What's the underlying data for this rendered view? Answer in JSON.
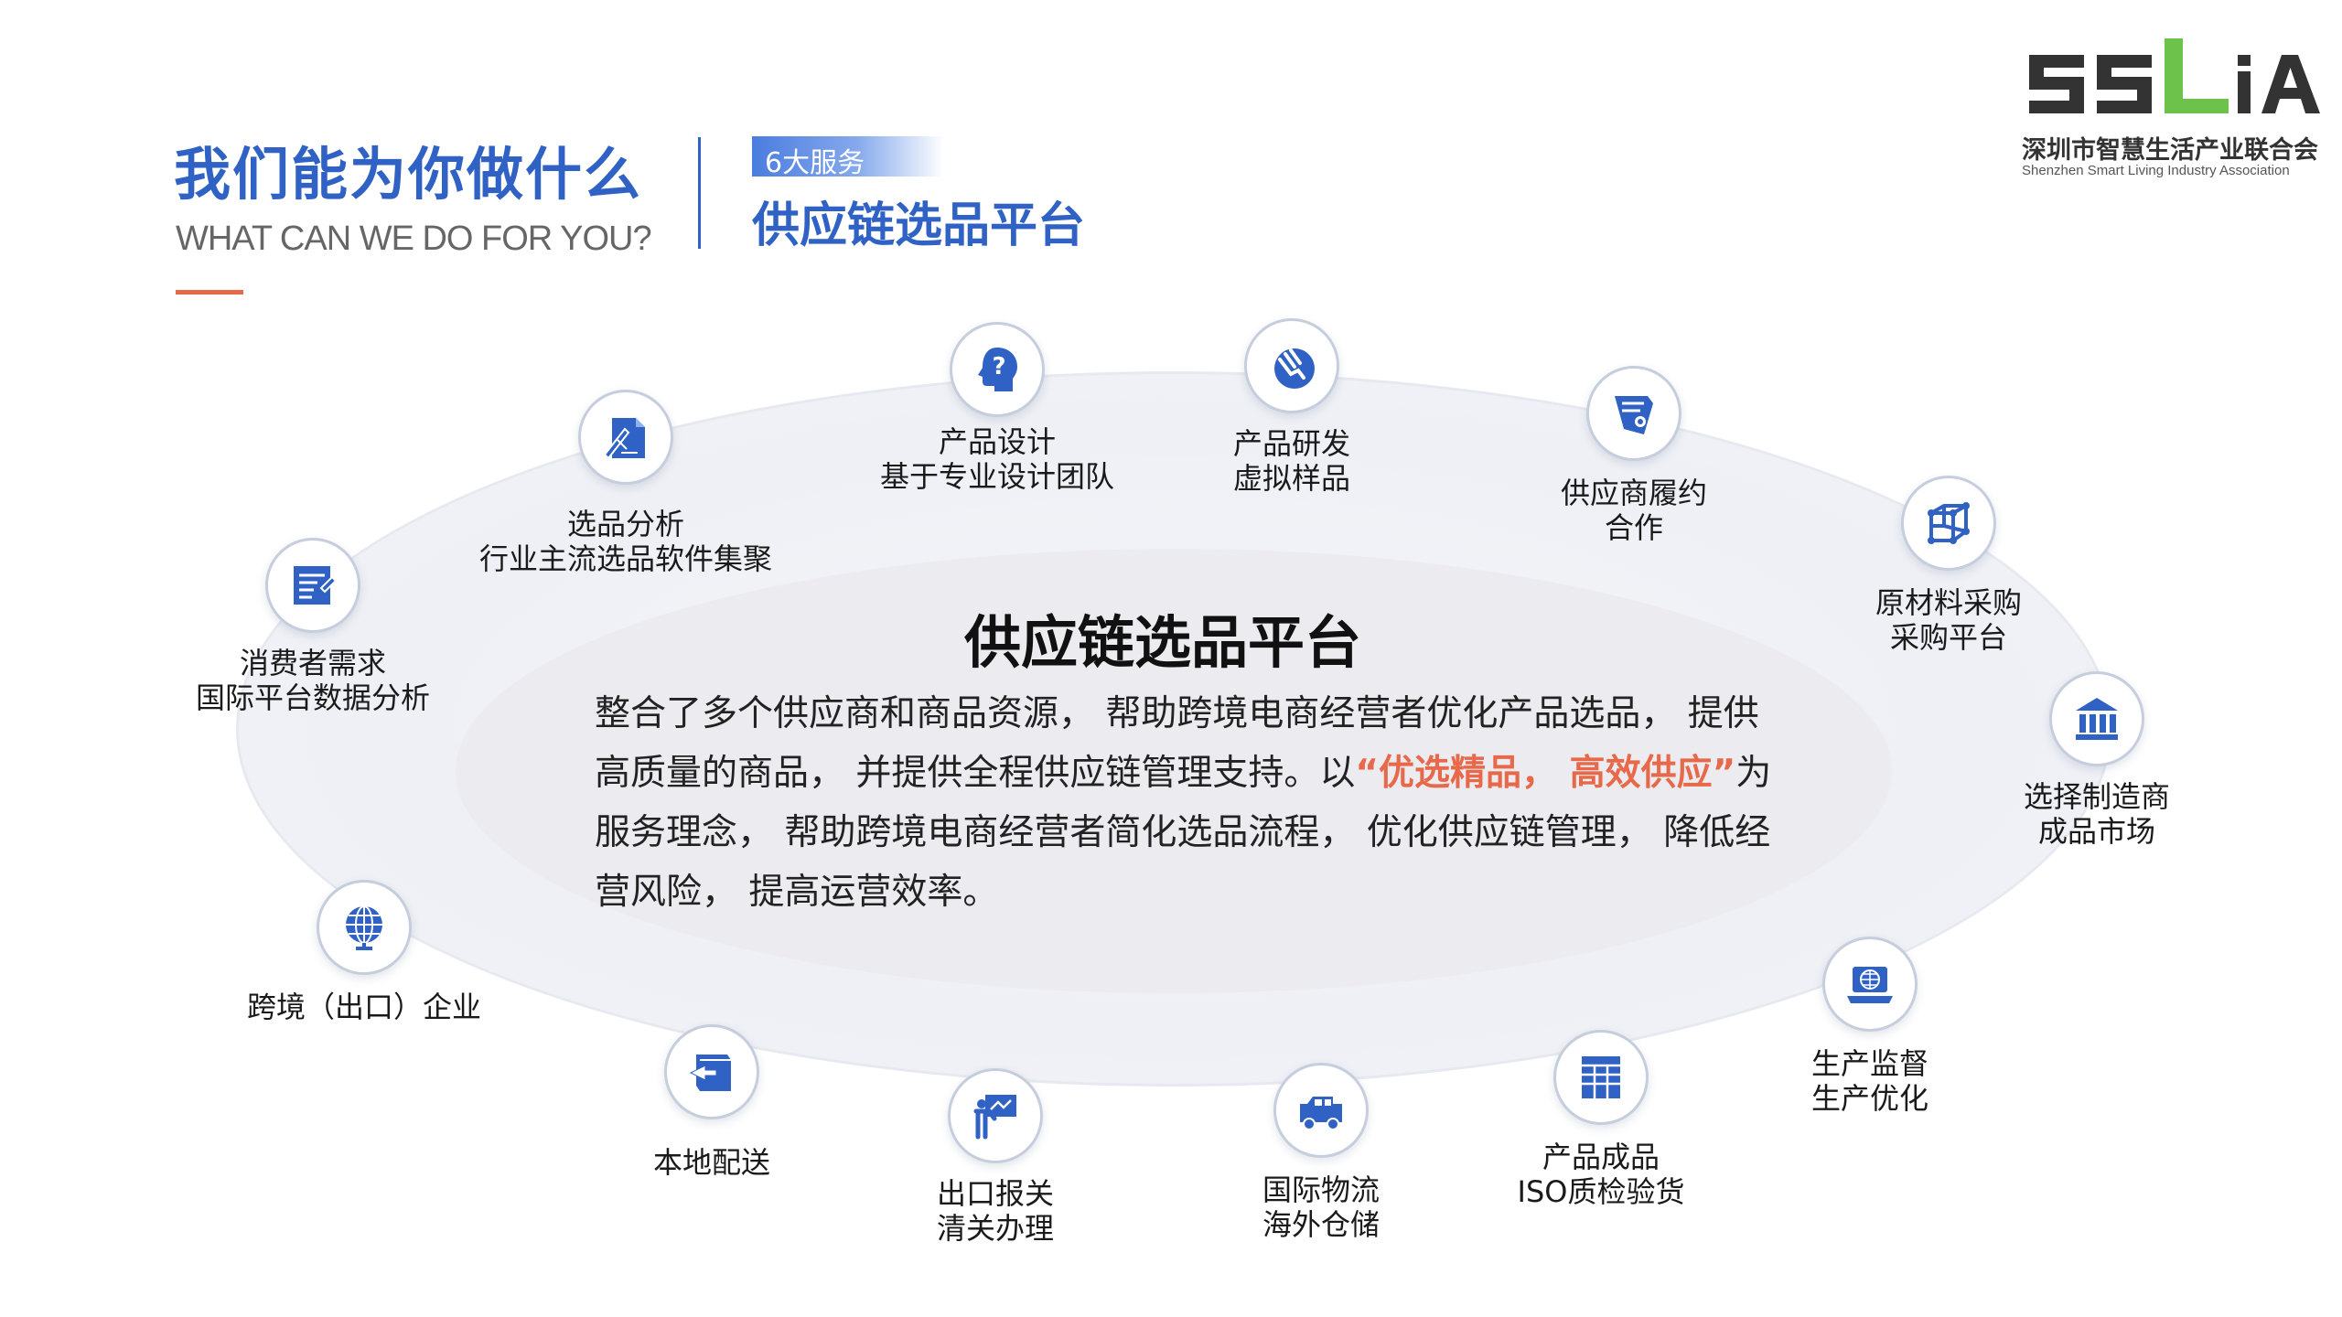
{
  "header": {
    "title": "我们能为你做什么",
    "subtitle": "WHAT CAN WE DO FOR YOU?",
    "service_badge": "6大服务",
    "service_title": "供应链选品平台"
  },
  "logo": {
    "mark": "SSLiA",
    "name_cn": "深圳市智慧生活产业联合会",
    "name_en": "Shenzhen Smart Living Industry Association"
  },
  "center": {
    "title": "供应链选品平台",
    "desc_part1": "整合了多个供应商和商品资源， 帮助跨境电商经营者优化产品选品， 提供高质量的商品， 并提供全程供应链管理支持。以",
    "desc_highlight": "“优选精品， 高效供应”",
    "desc_part2": "为服务理念， 帮助跨境电商经营者简化选品流程， 优化供应链管理， 降低经营风险， 提高运营效率。"
  },
  "colors": {
    "brand_blue": "#2f62c4",
    "accent_orange": "#e8684a",
    "logo_green": "#6cc24a",
    "icon_blue": "#2f62c4"
  },
  "services": [
    {
      "icon": "question-head-icon",
      "line1": "产品设计",
      "line2": "基于专业设计团队"
    },
    {
      "icon": "touch-hand-icon",
      "line1": "产品研发",
      "line2": "虚拟样品"
    },
    {
      "icon": "contract-scroll-icon",
      "line1": "供应商履约",
      "line2": "合作"
    },
    {
      "icon": "cube-icon",
      "line1": "原材料采购",
      "line2": "采购平台"
    },
    {
      "icon": "bank-building-icon",
      "line1": "选择制造商",
      "line2": "成品市场"
    },
    {
      "icon": "laptop-globe-icon",
      "line1": "生产监督",
      "line2": "生产优化"
    },
    {
      "icon": "grid-table-icon",
      "line1": "产品成品",
      "line2": "ISO质检验货"
    },
    {
      "icon": "truck-icon",
      "line1": "国际物流",
      "line2": "海外仓储"
    },
    {
      "icon": "presenter-board-icon",
      "line1": "出口报关",
      "line2": "清关办理"
    },
    {
      "icon": "box-arrow-icon",
      "line1": "本地配送",
      "line2": ""
    },
    {
      "icon": "globe-icon",
      "line1": "跨境（出口）企业",
      "line2": ""
    },
    {
      "icon": "document-list-icon",
      "line1": "消费者需求",
      "line2": "国际平台数据分析"
    },
    {
      "icon": "pen-document-icon",
      "line1": "选品分析",
      "line2": "行业主流选品软件集聚"
    }
  ]
}
